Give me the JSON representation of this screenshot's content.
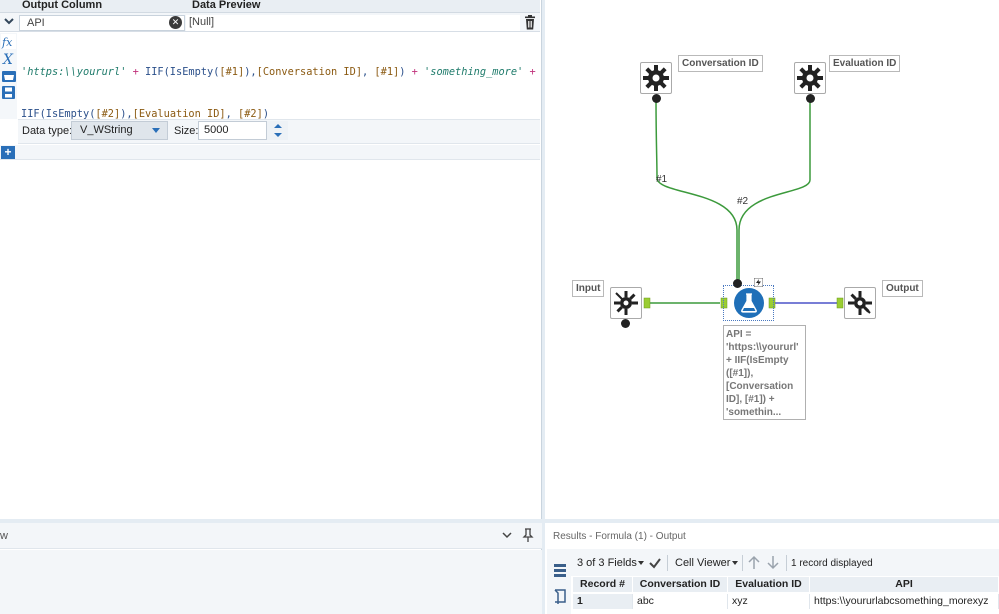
{
  "formula_panel": {
    "header": {
      "output_column": "Output Column",
      "data_preview": "Data Preview"
    },
    "row": {
      "output_field": "API",
      "preview_value": "[Null]"
    },
    "expression": {
      "line1": [
        {
          "t": "'https:\\\\yoururl'",
          "c": "str"
        },
        {
          "t": " + ",
          "c": "op"
        },
        {
          "t": "IIF(IsEmpty(",
          "c": "fn"
        },
        {
          "t": "[#1]",
          "c": "fld"
        },
        {
          "t": "),",
          "c": "fn"
        },
        {
          "t": "[Conversation ID]",
          "c": "fld"
        },
        {
          "t": ", ",
          "c": "fn"
        },
        {
          "t": "[#1]",
          "c": "fld"
        },
        {
          "t": ")",
          "c": "fn"
        },
        {
          "t": " + ",
          "c": "op"
        },
        {
          "t": "'something_more'",
          "c": "str"
        },
        {
          "t": " +",
          "c": "op"
        }
      ],
      "line2": [
        {
          "t": "IIF(IsEmpty(",
          "c": "fn"
        },
        {
          "t": "[#2]",
          "c": "fld"
        },
        {
          "t": "),",
          "c": "fn"
        },
        {
          "t": "[Evaluation ID]",
          "c": "fld"
        },
        {
          "t": ", ",
          "c": "fn"
        },
        {
          "t": "[#2]",
          "c": "fld"
        },
        {
          "t": ")",
          "c": "fn"
        }
      ]
    },
    "data_type_label": "Data type:",
    "data_type_value": "V_WString",
    "size_label": "Size:",
    "size_value": "5000"
  },
  "canvas": {
    "labels": {
      "conversation_id": "Conversation ID",
      "evaluation_id": "Evaluation ID",
      "input": "Input",
      "output": "Output"
    },
    "connection_labels": {
      "c1": "#1",
      "c2": "#2"
    },
    "annotation": "API =\n'https:\\\\yoururl'\n+ IIF(IsEmpty\n([#1]),\n[Conversation\nID], [#1]) +\n'somethin..."
  },
  "bottom_left": {
    "title_fragment": "w"
  },
  "results": {
    "title": "Results - Formula (1) - Output",
    "fields_label": "3 of 3 Fields",
    "viewer_label": "Cell Viewer",
    "records_label": "1 record displayed",
    "columns": [
      "Record #",
      "Conversation ID",
      "Evaluation ID",
      "API"
    ],
    "rows": [
      {
        "record": "1",
        "conversation_id": "abc",
        "evaluation_id": "xyz",
        "api": "https:\\\\yoururlabcsomething_morexyz"
      }
    ]
  },
  "colors": {
    "accent": "#2a6fb8",
    "connector_green": "#3c9a3c",
    "connector_blue": "#4b53c8",
    "anchor_green": "#9acd32"
  }
}
